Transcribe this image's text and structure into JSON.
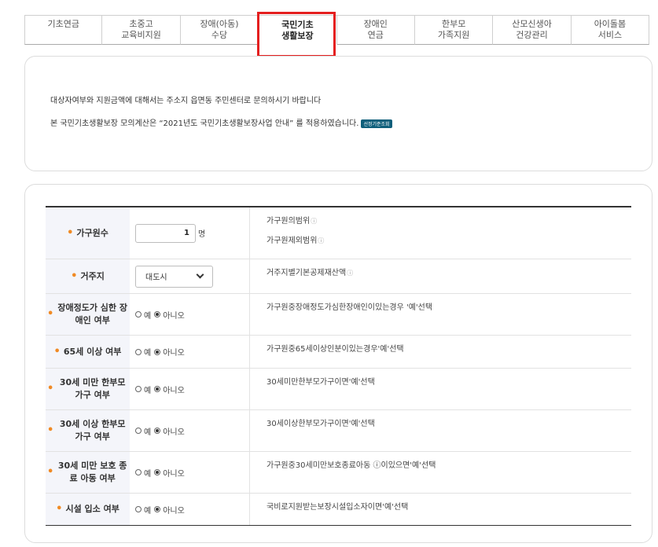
{
  "tabs": [
    {
      "line1": "기초연금",
      "line2": ""
    },
    {
      "line1": "초중고",
      "line2": "교육비지원"
    },
    {
      "line1": "장애(아동)",
      "line2": "수당"
    },
    {
      "line1": "국민기초",
      "line2": "생활보장"
    },
    {
      "line1": "장애인",
      "line2": "연금"
    },
    {
      "line1": "한부모",
      "line2": "가족지원"
    },
    {
      "line1": "산모신생아",
      "line2": "건강관리"
    },
    {
      "line1": "아이돌봄",
      "line2": "서비스"
    }
  ],
  "active_tab_index": 3,
  "notice": {
    "line1": "대상자여부와 지원금액에 대해서는 주소지 읍면동 주민센터로 문의하시기 바랍니다",
    "line2": "본 국민기초생활보장 모의계산은 “2021년도 국민기초생활보장사업 안내” 를 적용하였습니다.",
    "badge": "선정기준조회"
  },
  "form": {
    "household": {
      "label": "가구원수",
      "value": "1",
      "unit": "명",
      "desc1": "가구원의범위",
      "desc2": "가구원제외범위",
      "help": "ⓘ"
    },
    "residence": {
      "label": "거주지",
      "value": "대도시",
      "desc": "거주지별기본공제재산액",
      "help": "ⓘ"
    },
    "options": {
      "yes": "예",
      "no": "아니오"
    },
    "rows": [
      {
        "label": "장애정도가 심한 장애인 여부",
        "desc": "가구원중장애정도가심한장애인이있는경우 '예'선택",
        "selected": "no"
      },
      {
        "label": "65세 이상 여부",
        "desc": "가구원중65세이상인분이있는경우'예'선택",
        "selected": "no"
      },
      {
        "label": "30세 미만 한부모 가구 여부",
        "desc": "30세미만한부모가구이면'예'선택",
        "selected": "no"
      },
      {
        "label": "30세 이상 한부모 가구 여부",
        "desc": "30세이상한부모가구이면'예'선택",
        "selected": "no"
      },
      {
        "label": "30세 미만 보호 종료 아동 여부",
        "desc": "가구원중30세미만보호종료아동 ⓘ이있으면'예'선택",
        "selected": "no"
      },
      {
        "label": "시설 입소 여부",
        "desc": "국비로지원받는보장시설입소자이면'예'선택",
        "selected": "no"
      }
    ]
  },
  "colors": {
    "highlight": "#e41f1f",
    "bullet": "#f08a24",
    "badge": "#0f5f7b"
  }
}
